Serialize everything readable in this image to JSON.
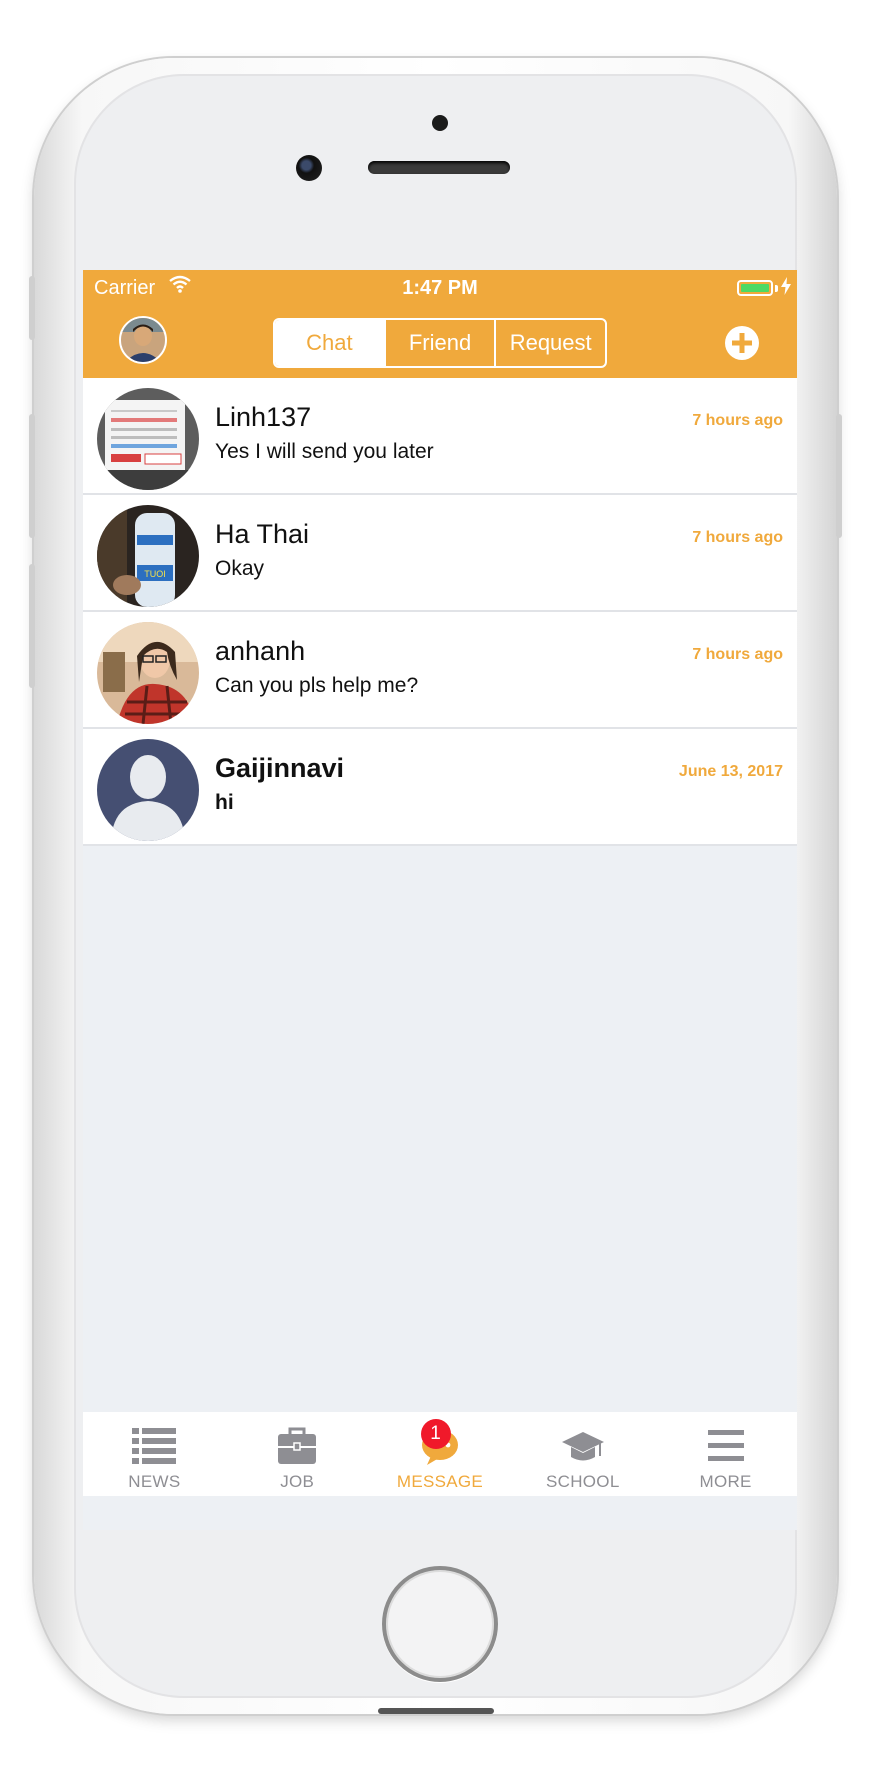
{
  "status_bar": {
    "carrier": "Carrier",
    "time": "1:47 PM"
  },
  "nav": {
    "segments": [
      {
        "label": "Chat",
        "active": true
      },
      {
        "label": "Friend",
        "active": false
      },
      {
        "label": "Request",
        "active": false
      }
    ],
    "add_icon": "plus-circle-icon",
    "accent_color": "#f0a93c"
  },
  "conversations": [
    {
      "name": "Linh137",
      "message": "Yes I will send you later",
      "time": "7 hours ago",
      "unread": false
    },
    {
      "name": "Ha Thai",
      "message": "Okay",
      "time": "7 hours ago",
      "unread": false
    },
    {
      "name": "anhanh",
      "message": "Can you pls help me?",
      "time": "7 hours ago",
      "unread": false
    },
    {
      "name": "Gaijinnavi",
      "message": "hi",
      "time": "June 13, 2017",
      "unread": true
    }
  ],
  "tab_bar": {
    "tabs": [
      {
        "label": "NEWS",
        "icon": "list-icon",
        "active": false
      },
      {
        "label": "JOB",
        "icon": "briefcase-icon",
        "active": false
      },
      {
        "label": "MESSAGE",
        "icon": "chat-bubble-icon",
        "active": true,
        "badge": "1"
      },
      {
        "label": "SCHOOL",
        "icon": "graduation-cap-icon",
        "active": false
      },
      {
        "label": "MORE",
        "icon": "hamburger-menu-icon",
        "active": false
      }
    ]
  }
}
